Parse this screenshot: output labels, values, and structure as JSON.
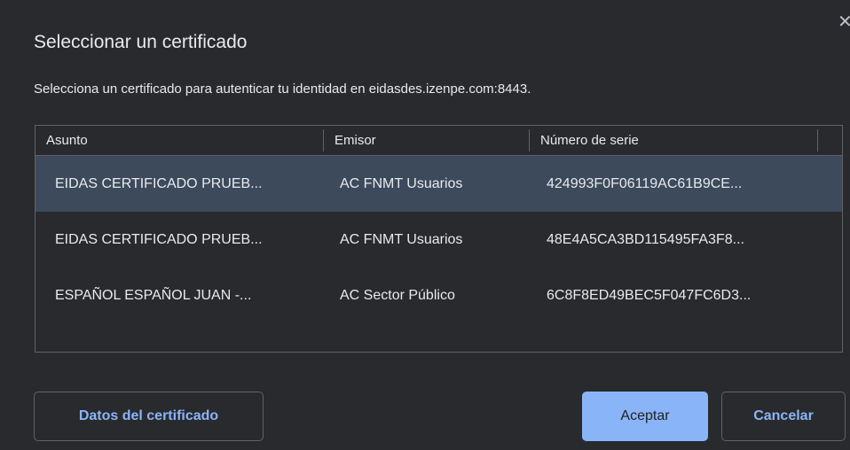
{
  "dialog": {
    "title": "Seleccionar un certificado",
    "subtitle": "Selecciona un certificado para autenticar tu identidad en eidasdes.izenpe.com:8443.",
    "close_icon": "close-icon"
  },
  "table": {
    "headers": {
      "asunto": "Asunto",
      "emisor": "Emisor",
      "serie": "Número de serie"
    },
    "rows": [
      {
        "asunto": "EIDAS CERTIFICADO PRUEB...",
        "emisor": "AC FNMT Usuarios",
        "serie": "424993F0F06119AC61B9CE...",
        "selected": true
      },
      {
        "asunto": "EIDAS CERTIFICADO PRUEB...",
        "emisor": "AC FNMT Usuarios",
        "serie": "48E4A5CA3BD115495FA3F8...",
        "selected": false
      },
      {
        "asunto": "ESPAÑOL ESPAÑOL JUAN -...",
        "emisor": "AC Sector Público",
        "serie": "6C8F8ED49BEC5F047FC6D3...",
        "selected": false
      }
    ]
  },
  "buttons": {
    "details": "Datos del certificado",
    "accept": "Aceptar",
    "cancel": "Cancelar"
  },
  "colors": {
    "background": "#292a2d",
    "accent": "#8ab4f8",
    "selected_row": "#3c4a5c",
    "text": "#e8eaed",
    "border": "#5f6368"
  }
}
